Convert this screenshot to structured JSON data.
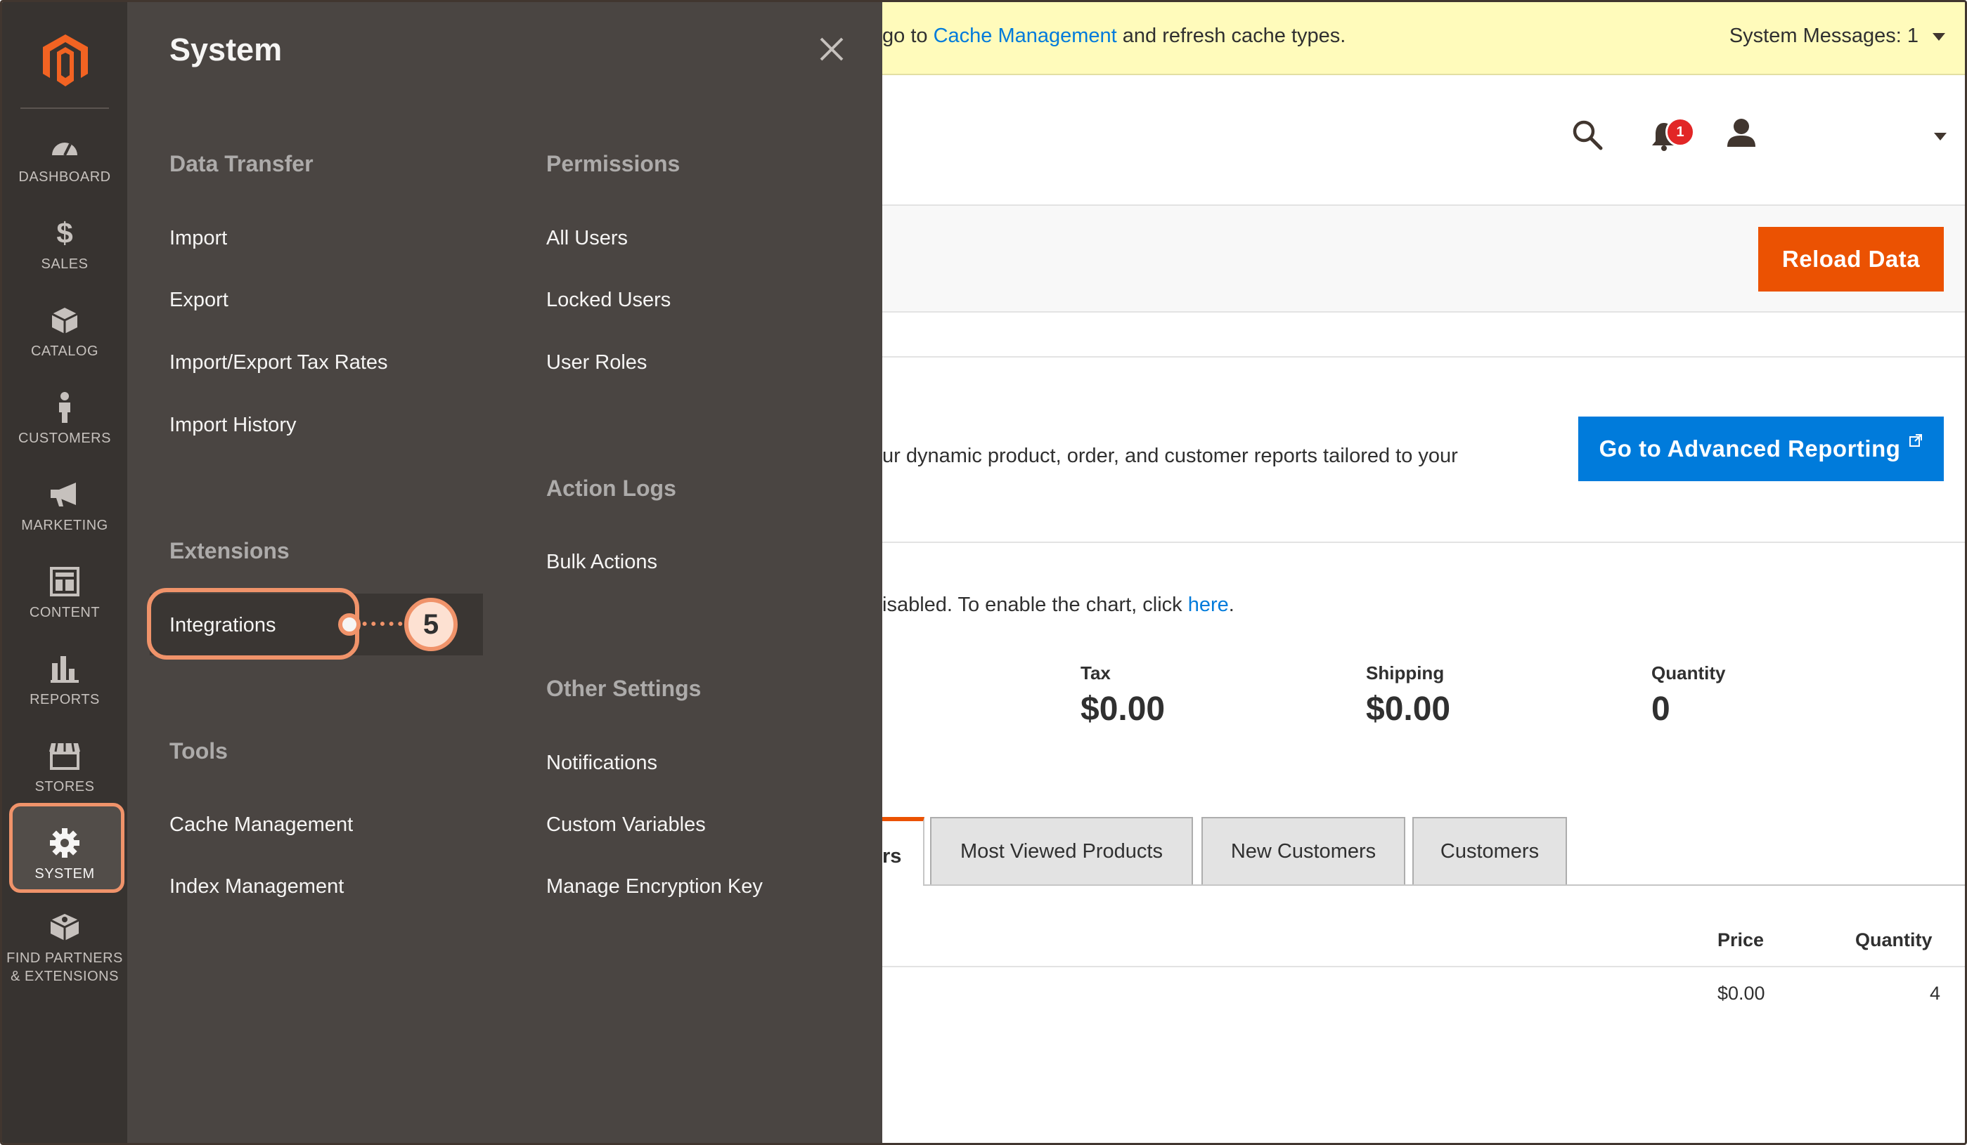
{
  "colors": {
    "nav_bg": "#373330",
    "flyout_bg": "#4a4542",
    "accent_orange": "#eb5202",
    "callout_orange": "#f0936a",
    "link_blue": "#007bdb",
    "message_bg": "#fffbbb",
    "badge_red": "#e22626"
  },
  "admin_nav": {
    "logo_icon": "magento-logo-icon",
    "items": [
      {
        "label": "DASHBOARD",
        "icon": "speedometer-icon"
      },
      {
        "label": "SALES",
        "icon": "dollar-icon"
      },
      {
        "label": "CATALOG",
        "icon": "box-icon"
      },
      {
        "label": "CUSTOMERS",
        "icon": "person-icon"
      },
      {
        "label": "MARKETING",
        "icon": "megaphone-icon"
      },
      {
        "label": "CONTENT",
        "icon": "layout-icon"
      },
      {
        "label": "REPORTS",
        "icon": "bar-chart-icon"
      },
      {
        "label": "STORES",
        "icon": "storefront-icon"
      },
      {
        "label": "SYSTEM",
        "icon": "gear-icon"
      },
      {
        "label_line1": "FIND PARTNERS",
        "label_line2": "& EXTENSIONS",
        "icon": "puzzle-box-icon"
      }
    ]
  },
  "flyout": {
    "title": "System",
    "close_icon": "close-icon",
    "col1": {
      "data_transfer": {
        "heading": "Data Transfer",
        "links": [
          "Import",
          "Export",
          "Import/Export Tax Rates",
          "Import History"
        ]
      },
      "extensions": {
        "heading": "Extensions",
        "links": [
          "Integrations"
        ]
      },
      "tools": {
        "heading": "Tools",
        "links": [
          "Cache Management",
          "Index Management"
        ]
      }
    },
    "col2": {
      "permissions": {
        "heading": "Permissions",
        "links": [
          "All Users",
          "Locked Users",
          "User Roles"
        ]
      },
      "action_logs": {
        "heading": "Action Logs",
        "links": [
          "Bulk Actions"
        ]
      },
      "other_settings": {
        "heading": "Other Settings",
        "links": [
          "Notifications",
          "Custom Variables",
          "Manage Encryption Key"
        ]
      }
    },
    "callout_number": "5"
  },
  "message_bar": {
    "text_prefix": "go to ",
    "link": "Cache Management",
    "text_suffix": " and refresh cache types.",
    "system_messages": "System Messages: 1"
  },
  "header": {
    "search_icon": "search-icon",
    "bell_icon": "bell-icon",
    "notification_count": "1",
    "user_icon": "user-icon"
  },
  "actions": {
    "reload_label": "Reload Data"
  },
  "advanced_reporting": {
    "text": "ur dynamic product, order, and customer reports tailored to your",
    "button_label": "Go to Advanced Reporting"
  },
  "chart_notice": {
    "text_prefix": "isabled. To enable the chart, click ",
    "link": "here",
    "text_suffix": "."
  },
  "stats": [
    {
      "label": "Tax",
      "value": "$0.00"
    },
    {
      "label": "Shipping",
      "value": "$0.00"
    },
    {
      "label": "Quantity",
      "value": "0"
    }
  ],
  "tabs": {
    "active_fragment": "rs",
    "items": [
      "Most Viewed Products",
      "New Customers",
      "Customers"
    ]
  },
  "grid": {
    "headers": [
      "Price",
      "Quantity"
    ],
    "rows": [
      {
        "price": "$0.00",
        "quantity": "4"
      }
    ]
  }
}
